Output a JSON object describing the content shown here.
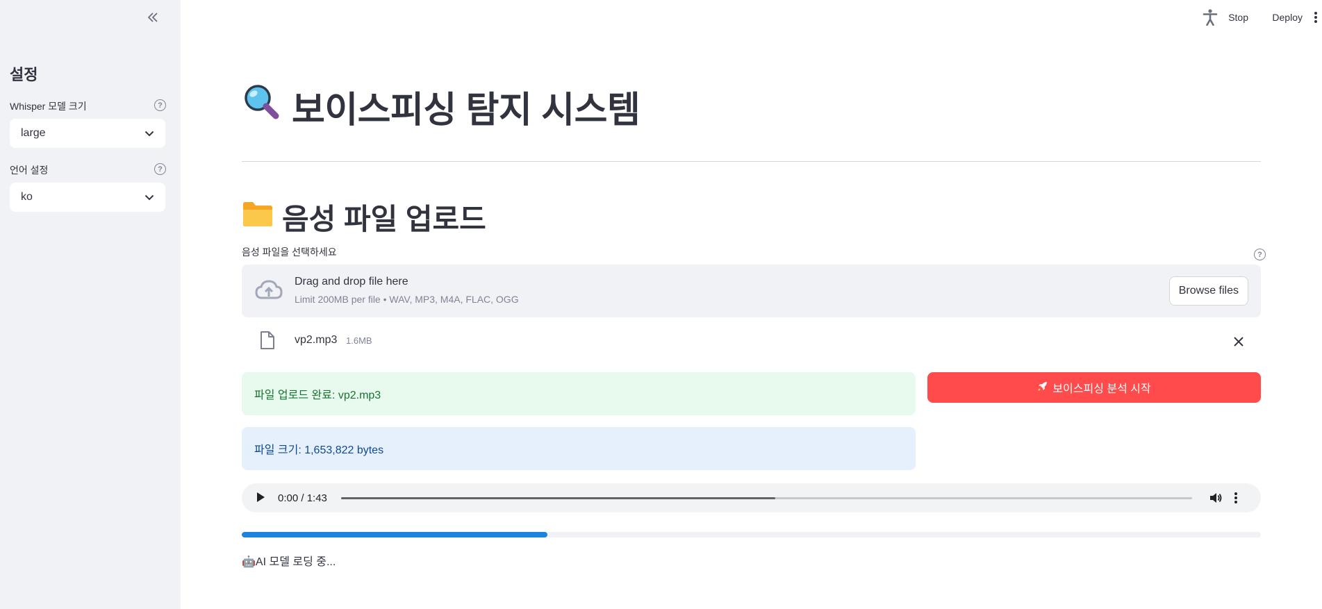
{
  "sidebar": {
    "title": "설정",
    "model_label": "Whisper 모델 크기",
    "model_value": "large",
    "lang_label": "언어 설정",
    "lang_value": "ko"
  },
  "topbar": {
    "stop_label": "Stop",
    "deploy_label": "Deploy"
  },
  "main": {
    "title": "보이스피싱 탐지 시스템",
    "upload_heading": "음성 파일 업로드",
    "upload_label": "음성 파일을 선택하세요",
    "dropzone_main": "Drag and drop file here",
    "dropzone_sub": "Limit 200MB per file • WAV, MP3, M4A, FLAC, OGG",
    "browse_label": "Browse files",
    "file_name": "vp2.mp3",
    "file_size": "1.6MB",
    "success_msg": "파일 업로드 완료: vp2.mp3",
    "info_msg": "파일 크기: 1,653,822 bytes",
    "analyze_label": "보이스피싱 분석 시작",
    "audio_time": "0:00 / 1:43",
    "audio_played_fraction": 0.51,
    "progress_fraction": 0.3,
    "status_text": "🤖AI 모델 로딩 중..."
  },
  "colors": {
    "primary": "#ff4b4b",
    "progress": "#1c83e1",
    "success_bg": "#e8f9ee",
    "info_bg": "#e6f0fc"
  },
  "icons": [
    "collapse-sidebar-icon",
    "help-icon",
    "chevron-down-icon",
    "accessibility-icon",
    "kebab-menu-icon",
    "magnifier-icon",
    "folder-icon",
    "upload-cloud-icon",
    "file-icon",
    "close-icon",
    "rocket-icon",
    "play-icon",
    "volume-icon"
  ]
}
